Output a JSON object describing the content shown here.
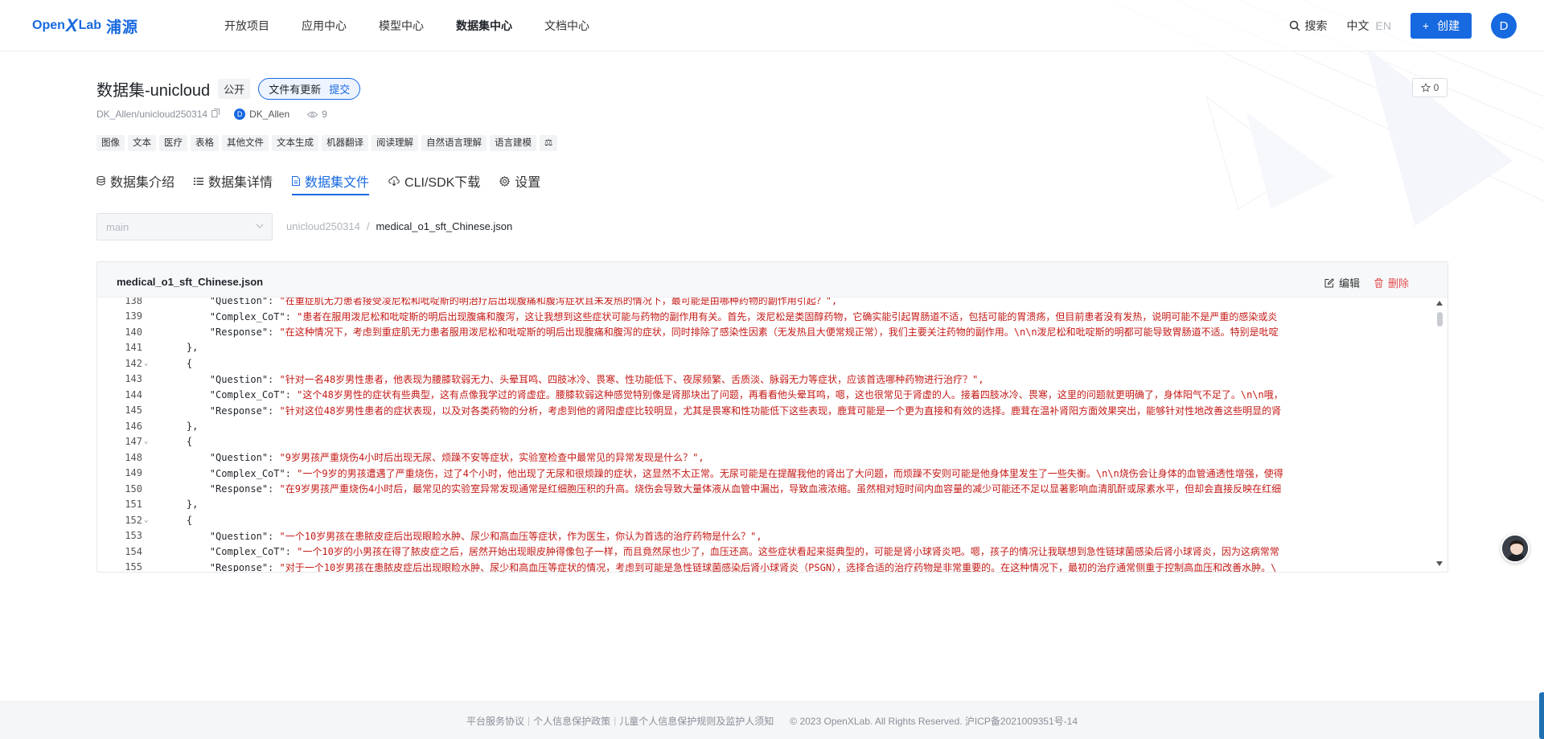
{
  "brand": {
    "open": "Open",
    "x": "X",
    "lab": "Lab",
    "cn": "浦源"
  },
  "nav": {
    "items": [
      {
        "label": "开放项目",
        "active": false
      },
      {
        "label": "应用中心",
        "active": false
      },
      {
        "label": "模型中心",
        "active": false
      },
      {
        "label": "数据集中心",
        "active": true
      },
      {
        "label": "文档中心",
        "active": false
      }
    ],
    "search_label": "搜索",
    "lang_cn": "中文",
    "lang_en": "EN",
    "create_label": "创建",
    "avatar_letter": "D"
  },
  "dataset": {
    "title": "数据集-unicloud",
    "visibility": "公开",
    "update_text": "文件有更新",
    "submit_label": "提交",
    "repo_path": "DK_Allen/unicloud250314",
    "owner_initial": "D",
    "owner": "DK_Allen",
    "views": "9",
    "stars": "0",
    "tags": [
      "图像",
      "文本",
      "医疗",
      "表格",
      "其他文件",
      "文本生成",
      "机器翻译",
      "阅读理解",
      "自然语言理解",
      "语言建模",
      "⚖"
    ]
  },
  "tabs": [
    {
      "label": "数据集介绍",
      "icon": "database-icon",
      "active": false
    },
    {
      "label": "数据集详情",
      "icon": "list-icon",
      "active": false
    },
    {
      "label": "数据集文件",
      "icon": "file-icon",
      "active": true
    },
    {
      "label": "CLI/SDK下载",
      "icon": "cloud-download-icon",
      "active": false
    },
    {
      "label": "设置",
      "icon": "gear-icon",
      "active": false
    }
  ],
  "branch": {
    "value": "main"
  },
  "breadcrumb": {
    "root": "unicloud250314",
    "sep": "/",
    "file": "medical_o1_sft_Chinese.json"
  },
  "file": {
    "name": "medical_o1_sft_Chinese.json",
    "edit_label": "编辑",
    "delete_label": "删除",
    "lines": [
      {
        "n": "138",
        "fold": false,
        "indent": "    ",
        "key": "\"Question\"",
        "value": "\"在重症肌无力患者接受凌尼松和吡啶斯的明治疗后出现腹痛和腹泻症状且未发热的情况下，最可能是由哪种药物的副作用引起？\","
      },
      {
        "n": "139",
        "fold": false,
        "indent": "    ",
        "key": "\"Complex_CoT\"",
        "value": "\"患者在服用泼尼松和吡啶斯的明后出现腹痛和腹泻，这让我想到这些症状可能与药物的副作用有关。首先，泼尼松是类固醇药物，它确实能引起胃肠道不适，包括可能的胃溃疡，但目前患者没有发热，说明可能不是严重的感染或炎"
      },
      {
        "n": "140",
        "fold": false,
        "indent": "    ",
        "key": "\"Response\"",
        "value": "\"在这种情况下，考虑到重症肌无力患者服用泼尼松和吡啶斯的明后出现腹痛和腹泻的症状，同时排除了感染性因素（无发热且大便常规正常），我们主要关注药物的副作用。\\n\\n泼尼松和吡啶斯的明都可能导致胃肠道不适。特别是吡啶"
      },
      {
        "n": "141",
        "fold": false,
        "indent": "",
        "key": "",
        "value": "},"
      },
      {
        "n": "142",
        "fold": true,
        "indent": "",
        "key": "",
        "value": "{"
      },
      {
        "n": "143",
        "fold": false,
        "indent": "    ",
        "key": "\"Question\"",
        "value": "\"针对一名48岁男性患者，他表现为腰膝软弱无力、头晕耳鸣、四肢冰冷、畏寒、性功能低下、夜尿频繁、舌质淡、脉弱无力等症状，应该首选哪种药物进行治疗？\","
      },
      {
        "n": "144",
        "fold": false,
        "indent": "    ",
        "key": "\"Complex_CoT\"",
        "value": "\"这个48岁男性的症状有些典型，这有点像我学过的肾虚症。腰膝软弱这种感觉特别像是肾那块出了问题，再看看他头晕耳鸣，嗯，这也很常见于肾虚的人。接着四肢冰冷、畏寒，这里的问题就更明确了，身体阳气不足了。\\n\\n哦，"
      },
      {
        "n": "145",
        "fold": false,
        "indent": "    ",
        "key": "\"Response\"",
        "value": "\"针对这位48岁男性患者的症状表现，以及对各类药物的分析，考虑到他的肾阳虚症比较明显，尤其是畏寒和性功能低下这些表现，鹿茸可能是一个更为直接和有效的选择。鹿茸在温补肾阳方面效果突出，能够针对性地改善这些明显的肾"
      },
      {
        "n": "146",
        "fold": false,
        "indent": "",
        "key": "",
        "value": "},"
      },
      {
        "n": "147",
        "fold": true,
        "indent": "",
        "key": "",
        "value": "{"
      },
      {
        "n": "148",
        "fold": false,
        "indent": "    ",
        "key": "\"Question\"",
        "value": "\"9岁男孩严重烧伤4小时后出现无尿、烦躁不安等症状，实验室检查中最常见的异常发现是什么？\","
      },
      {
        "n": "149",
        "fold": false,
        "indent": "    ",
        "key": "\"Complex_CoT\"",
        "value": "\"一个9岁的男孩遭遇了严重烧伤，过了4个小时，他出现了无尿和很烦躁的症状，这显然不太正常。无尿可能是在提醒我他的肾出了大问题，而烦躁不安则可能是他身体里发生了一些失衡。\\n\\n烧伤会让身体的血管通透性增强，使得"
      },
      {
        "n": "150",
        "fold": false,
        "indent": "    ",
        "key": "\"Response\"",
        "value": "\"在9岁男孩严重烧伤4小时后，最常见的实验室异常发现通常是红细胞压积的升高。烧伤会导致大量体液从血管中漏出，导致血液浓缩。虽然相对短时间内血容量的减少可能还不足以显著影响血清肌酐或尿素水平，但却会直接反映在红细"
      },
      {
        "n": "151",
        "fold": false,
        "indent": "",
        "key": "",
        "value": "},"
      },
      {
        "n": "152",
        "fold": true,
        "indent": "",
        "key": "",
        "value": "{"
      },
      {
        "n": "153",
        "fold": false,
        "indent": "    ",
        "key": "\"Question\"",
        "value": "\"一个10岁男孩在患脓皮症后出现眼睑水肿、尿少和高血压等症状，作为医生，你认为首选的治疗药物是什么？\","
      },
      {
        "n": "154",
        "fold": false,
        "indent": "    ",
        "key": "\"Complex_CoT\"",
        "value": "\"一个10岁的小男孩在得了脓皮症之后，居然开始出现眼皮肿得像包子一样，而且竟然尿也少了，血压还高。这些症状看起来挺典型的，可能是肾小球肾炎吧。嗯，孩子的情况让我联想到急性链球菌感染后肾小球肾炎，因为这病常常"
      },
      {
        "n": "155",
        "fold": false,
        "indent": "    ",
        "key": "\"Response\"",
        "value": "\"对于一个10岁男孩在患脓皮症后出现眼睑水肿、尿少和高血压等症状的情况，考虑到可能是急性链球菌感染后肾小球肾炎（PSGN），选择合适的治疗药物是非常重要的。在这种情况下，最初的治疗通常侧重于控制高血压和改善水肿。\\"
      }
    ]
  },
  "footer": {
    "links": [
      "平台服务协议",
      "个人信息保护政策",
      "儿童个人信息保护规则及监护人须知"
    ],
    "copyright": "© 2023 OpenXLab. All Rights Reserved. 沪ICP备2021009351号-14"
  },
  "colors": {
    "accent": "#1769e0",
    "danger": "#e34d4d",
    "string": "#c41a16"
  }
}
